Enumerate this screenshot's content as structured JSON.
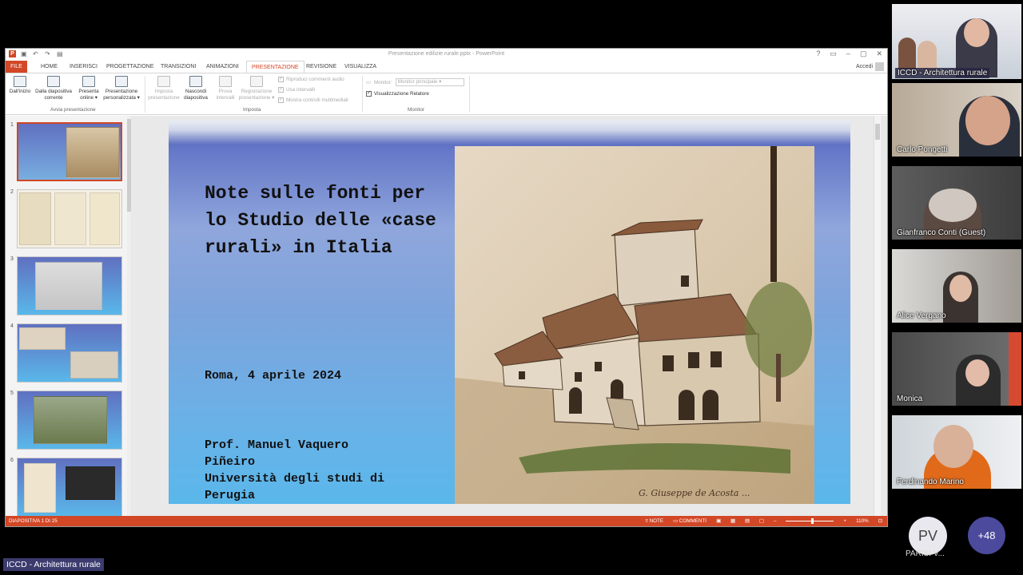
{
  "window": {
    "title": "Presentazione edilizie rurale.pptx - PowerPoint",
    "account": "Accedi"
  },
  "tabs": [
    {
      "label": "FILE"
    },
    {
      "label": "HOME"
    },
    {
      "label": "INSERISCI"
    },
    {
      "label": "PROGETTAZIONE"
    },
    {
      "label": "TRANSIZIONI"
    },
    {
      "label": "ANIMAZIONI"
    },
    {
      "label": "PRESENTAZIONE"
    },
    {
      "label": "REVISIONE"
    },
    {
      "label": "VISUALIZZA"
    }
  ],
  "ribbon": {
    "from_start": "Dall'inizio",
    "from_current_1": "Dalla diapositiva",
    "from_current_2": "corrente",
    "present_online_1": "Presenta",
    "present_online_2": "online ▾",
    "custom_1": "Presentazione",
    "custom_2": "personalizzata ▾",
    "group_start": "Avvia presentazione",
    "setup_1": "Imposta",
    "setup_2": "presentazione",
    "hide_1": "Nascondi",
    "hide_2": "diapositiva",
    "rehearse_1": "Prova",
    "rehearse_2": "intervalli",
    "record_1": "Registrazione",
    "record_2": "presentazione ▾",
    "group_setup": "Imposta",
    "chk_narrations": "Riproduci commenti audio",
    "chk_timings": "Usa intervalli",
    "chk_media": "Mostra controlli multimediali",
    "monitor_label": "Monitor:",
    "monitor_value": "Monitor principale",
    "presenter_view": "Visualizzazione Relatore",
    "group_monitor": "Monitor"
  },
  "slides_panel": [
    {
      "num": "1"
    },
    {
      "num": "2"
    },
    {
      "num": "3"
    },
    {
      "num": "4"
    },
    {
      "num": "5"
    },
    {
      "num": "6"
    }
  ],
  "slide": {
    "title": "Note sulle fonti per lo Studio delle «case rurali» in Italia",
    "date": "Roma, 4 aprile 2024",
    "author_1": "Prof. Manuel Vaquero",
    "author_2": "Piñeiro",
    "author_3": "Università degli studi di",
    "author_4": "Perugia",
    "artwork_signature": "G. Giuseppe de Acosta ..."
  },
  "statusbar": {
    "slide_count": "DIAPOSITIVA 1 DI 25",
    "notes": "NOTE",
    "comments": "COMMENTI",
    "zoom": "110%"
  },
  "participants": [
    {
      "name": "ICCD - Architettura rurale"
    },
    {
      "name": "Carlo Pongetti"
    },
    {
      "name": "Gianfranco Conti (Guest)"
    },
    {
      "name": "Alice Vergano"
    },
    {
      "name": "Monica"
    },
    {
      "name": "Ferdinando Marino"
    }
  ],
  "extra": {
    "avatar_initials": "PV",
    "avatar_name": "PARISI V...",
    "more_count": "+48",
    "shared_by_label": "ICCD - Architettura rurale"
  },
  "colors": {
    "ppt_accent": "#d24726",
    "meeting_accent": "#4b4a9c"
  }
}
